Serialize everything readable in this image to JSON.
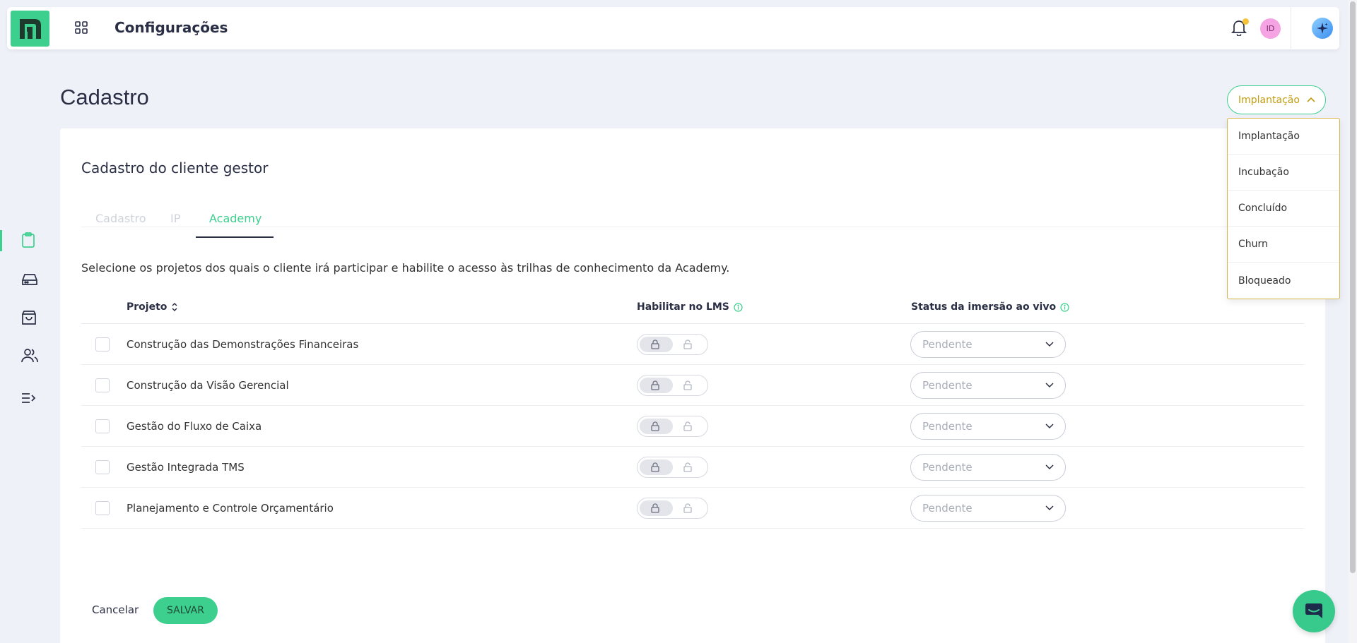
{
  "header": {
    "title": "Configurações",
    "avatar_initials": "ID",
    "icons": [
      "apps-grid-icon",
      "bell-icon",
      "sparkle-icon"
    ],
    "colors": {
      "brand": "#3ccf8e",
      "notification_dot": "#f5c335",
      "avatar_bg": "#f5a3e2"
    }
  },
  "sidebar": {
    "items": [
      {
        "icon": "clipboard-icon",
        "active": true
      },
      {
        "icon": "drive-icon",
        "active": false
      },
      {
        "icon": "shopping-bag-icon",
        "active": false
      },
      {
        "icon": "users-icon",
        "active": false
      },
      {
        "icon": "expand-menu-icon",
        "active": false
      }
    ]
  },
  "page": {
    "title": "Cadastro"
  },
  "status_dropdown": {
    "selected": "Implantação",
    "options": [
      "Implantação",
      "Incubação",
      "Concluído",
      "Churn",
      "Bloqueado"
    ],
    "color": "#c49b0c"
  },
  "card": {
    "title": "Cadastro do cliente gestor",
    "tabs": [
      {
        "label": "Cadastro",
        "active": false
      },
      {
        "label": "IP",
        "active": false
      },
      {
        "label": "Academy",
        "active": true
      }
    ],
    "intro": "Selecione os projetos dos quais o cliente irá participar e habilite o acesso às trilhas de conhecimento da Academy."
  },
  "table": {
    "columns": {
      "project": "Projeto",
      "lms": "Habilitar no LMS",
      "status": "Status da imersão ao vivo"
    },
    "rows": [
      {
        "project": "Construção das Demonstrações Financeiras",
        "status": "Pendente"
      },
      {
        "project": "Construção da Visão Gerencial",
        "status": "Pendente"
      },
      {
        "project": "Gestão do Fluxo de Caixa",
        "status": "Pendente"
      },
      {
        "project": "Gestão Integrada TMS",
        "status": "Pendente"
      },
      {
        "project": "Planejamento e Controle Orçamentário",
        "status": "Pendente"
      }
    ]
  },
  "footer": {
    "cancel_label": "Cancelar",
    "save_label": "SALVAR"
  }
}
